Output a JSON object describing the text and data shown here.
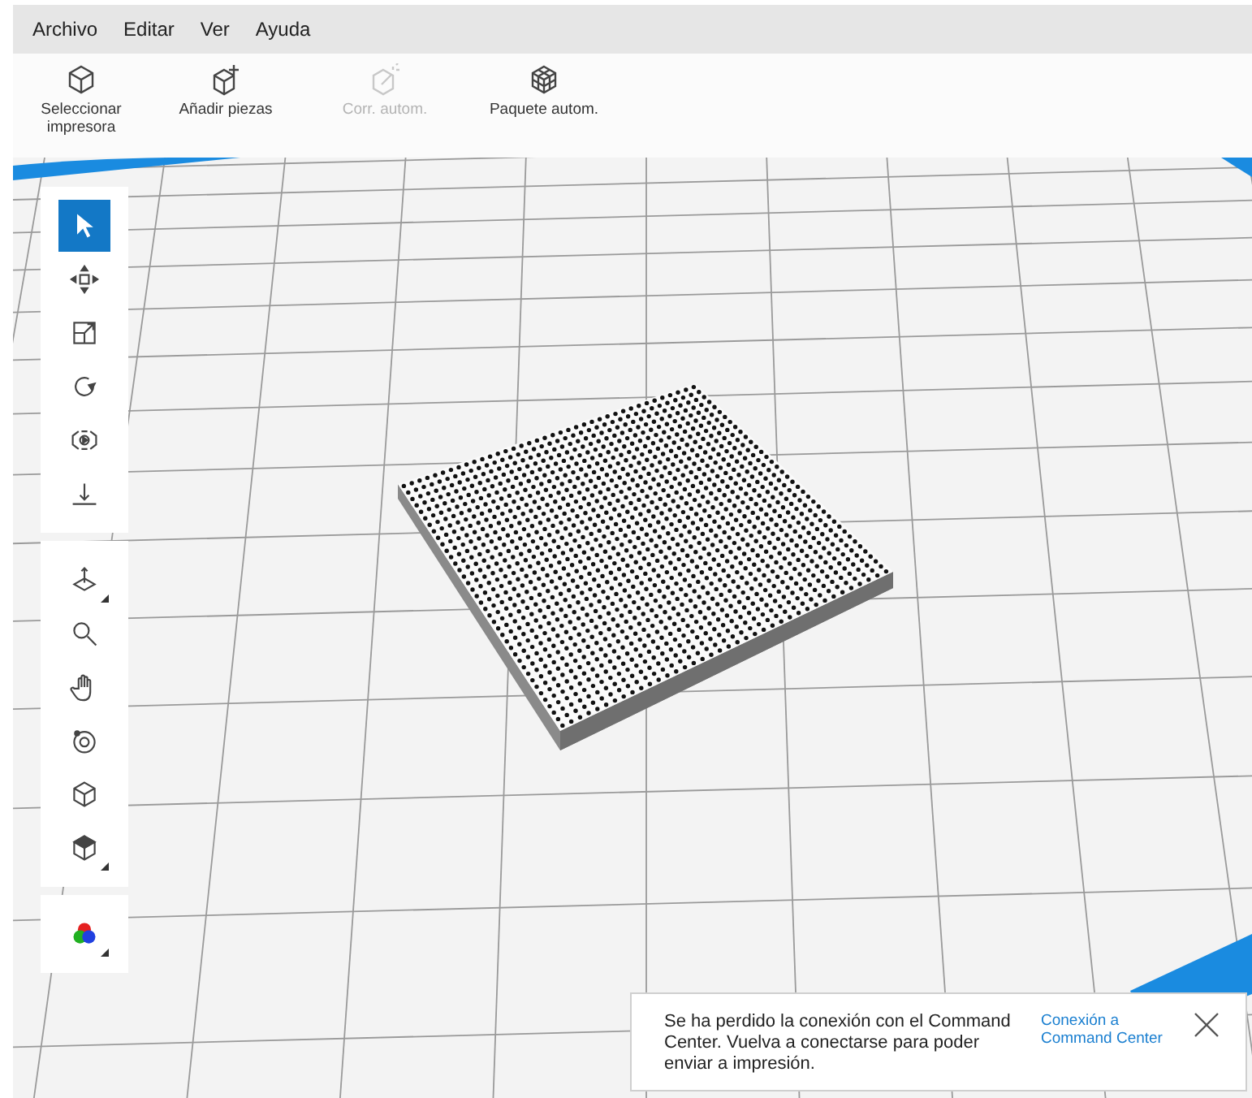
{
  "menu": [
    "Archivo",
    "Editar",
    "Ver",
    "Ayuda"
  ],
  "toolbar": [
    {
      "label": "Seleccionar impresora",
      "disabled": false
    },
    {
      "label": "Añadir piezas",
      "disabled": false
    },
    {
      "label": "Corr. autom.",
      "disabled": true
    },
    {
      "label": "Paquete autom.",
      "disabled": false
    }
  ],
  "tool_groups": [
    [
      {
        "selected": true
      },
      {
        "selected": false
      },
      {
        "selected": false
      },
      {
        "selected": false
      },
      {
        "selected": false
      },
      {
        "selected": false
      }
    ],
    [
      {
        "selected": false
      },
      {
        "selected": false
      },
      {
        "selected": false
      },
      {
        "selected": false
      },
      {
        "selected": false
      },
      {
        "selected": false
      }
    ],
    [
      {
        "selected": false
      }
    ]
  ],
  "notification": {
    "message": "Se ha perdido la conexión con el Command Center. Vuelva a conectarse para poder enviar a impresión.",
    "link": "Conexión a Command Center"
  }
}
